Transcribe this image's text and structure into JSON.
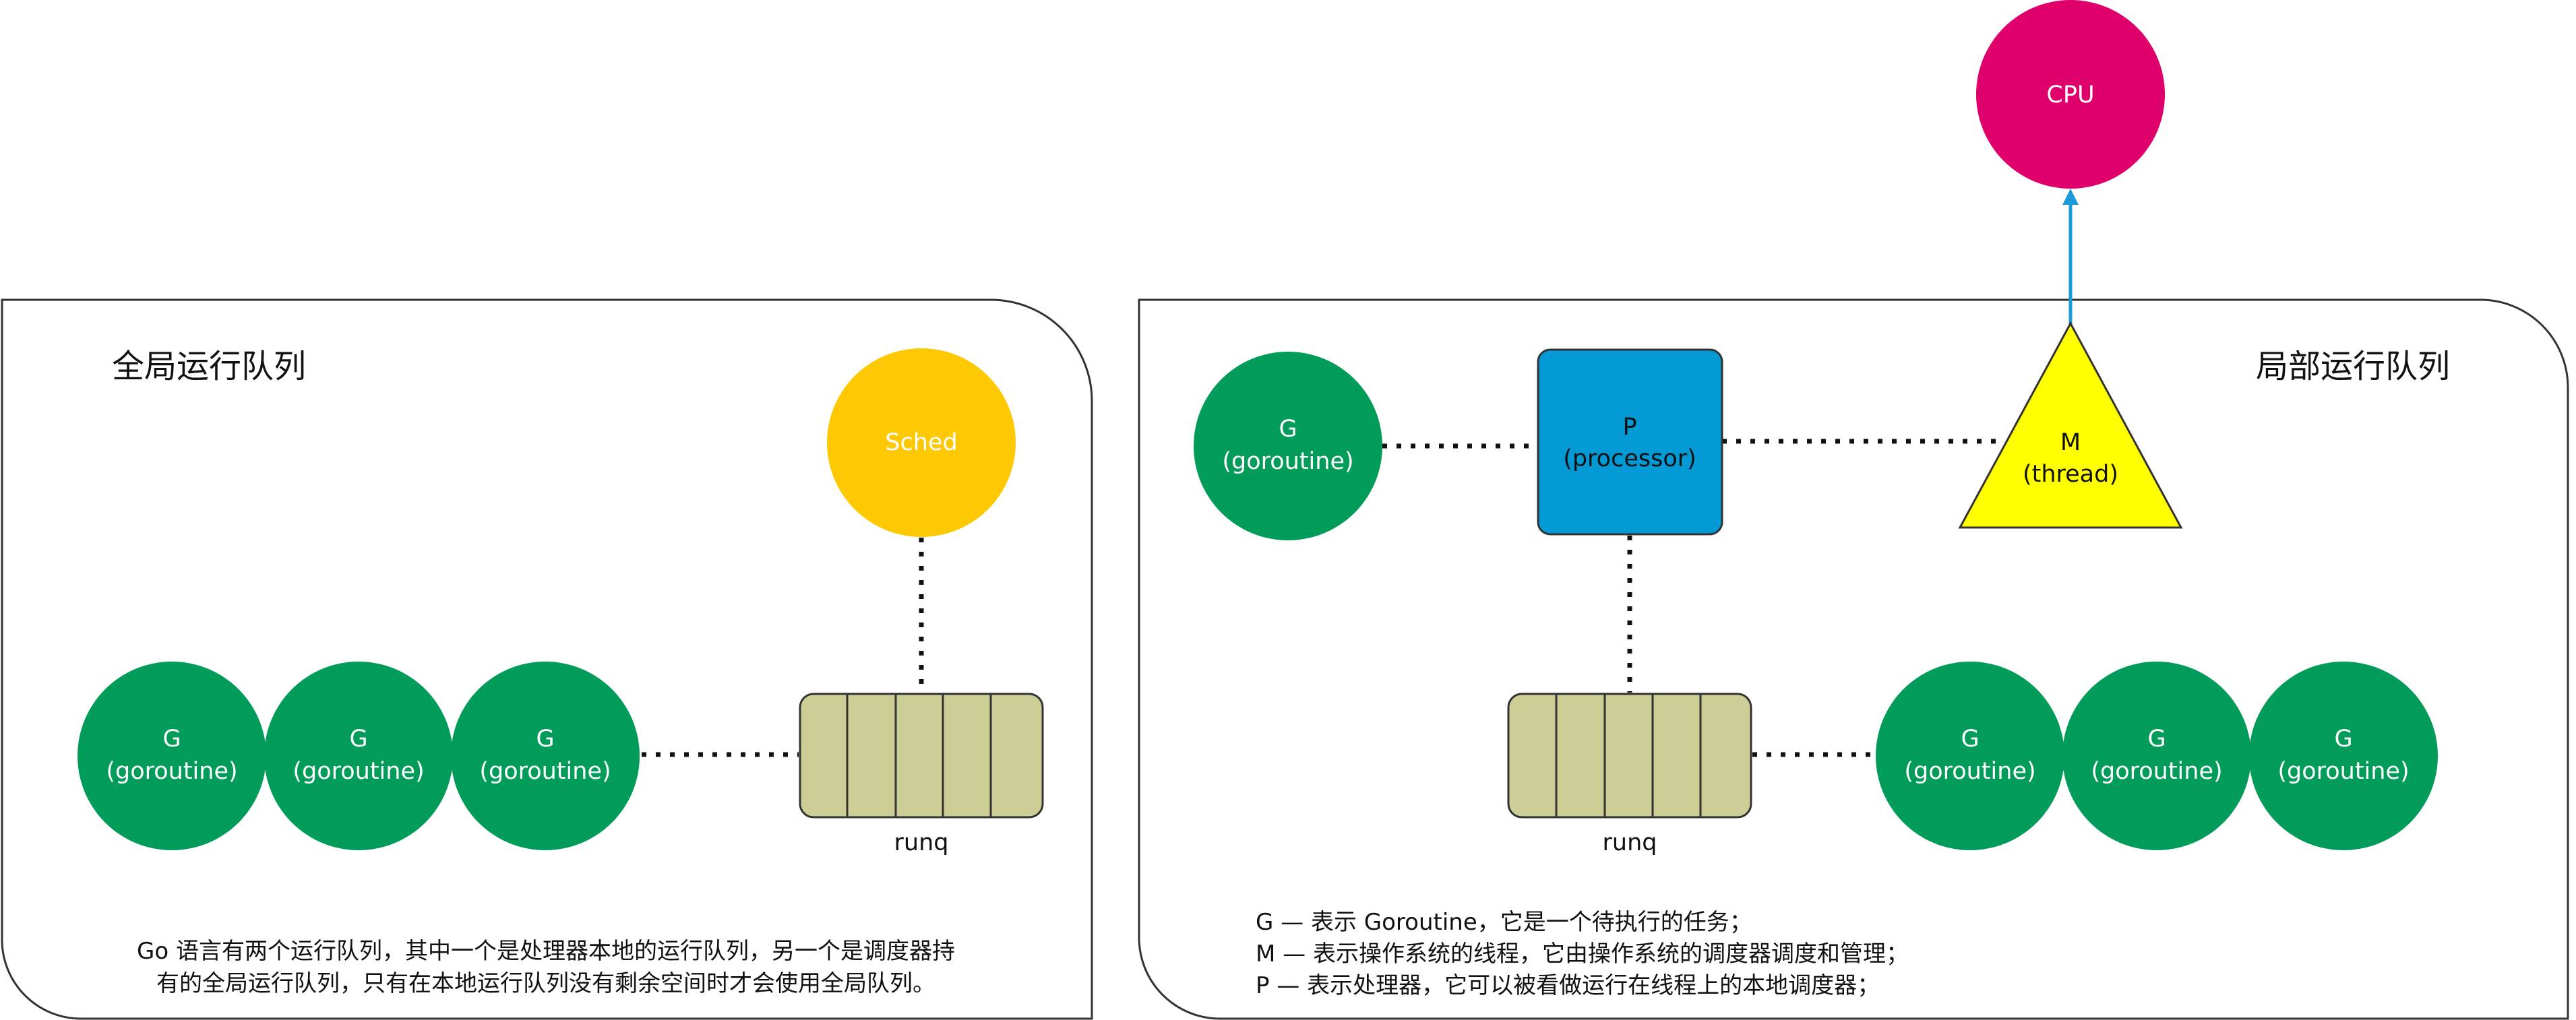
{
  "left_panel": {
    "title": "全局运行队列",
    "sched_label": "Sched",
    "g_items": [
      {
        "line1": "G",
        "line2": "(goroutine)"
      },
      {
        "line1": "G",
        "line2": "(goroutine)"
      },
      {
        "line1": "G",
        "line2": "(goroutine)"
      }
    ],
    "runq_label": "runq",
    "description": [
      "Go 语言有两个运行队列，其中一个是处理器本地的运行队列，另一个是调度器持",
      "有的全局运行队列，只有在本地运行队列没有剩余空间时才会使用全局队列。"
    ]
  },
  "right_panel": {
    "title": "局部运行队列",
    "cpu_label": "CPU",
    "g_top": {
      "line1": "G",
      "line2": "(goroutine)"
    },
    "p_box": {
      "line1": "P",
      "line2": "(processor)"
    },
    "m_triangle": {
      "line1": "M",
      "line2": "(thread)"
    },
    "runq_label": "runq",
    "g_items": [
      {
        "line1": "G",
        "line2": "(goroutine)"
      },
      {
        "line1": "G",
        "line2": "(goroutine)"
      },
      {
        "line1": "G",
        "line2": "(goroutine)"
      }
    ],
    "legend": [
      "G — 表示 Goroutine，它是一个待执行的任务；",
      "M — 表示操作系统的线程，它由操作系统的调度器调度和管理；",
      "P — 表示处理器，它可以被看做运行在线程上的本地调度器；"
    ]
  },
  "colors": {
    "goroutine": "#019C59",
    "sched": "#FEC802",
    "cpu": "#E0006C",
    "processor": "#0299D4",
    "thread": "#FFFF00",
    "runq": "#CDCD96",
    "arrow": "#1A9BD7"
  }
}
